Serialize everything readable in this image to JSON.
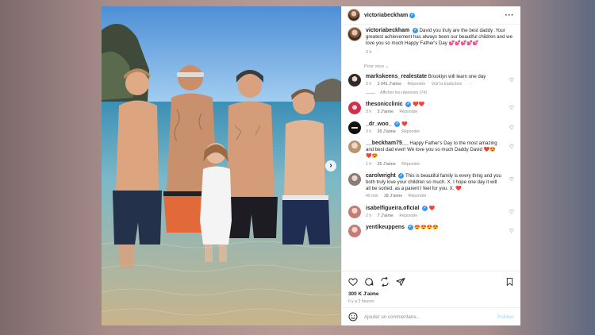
{
  "post": {
    "account": "victoriabeckham",
    "caption": "David you truly are the best daddy .Your greatest achievement has always been our beautiful children and we love you so much.Happy Father's Day 💕💕💕💕💕",
    "caption_time": "3 h",
    "section_label": "Pour vous",
    "likes": "300 K J'aime",
    "posted_ago": "Il y a 3 heures",
    "add_comment_placeholder": "Ajouter un commentaire...",
    "publish_label": "Publier"
  },
  "comments": [
    {
      "user": "markskeens_realestate",
      "verified": false,
      "text": "Brooklyn will learn one day",
      "time": "3 h",
      "likes": "3 041 J'aime",
      "reply": "Répondre",
      "translate": "Voir la traduction",
      "more": "···",
      "avatar": "dark"
    },
    {
      "user": "thesonicclinic",
      "verified": true,
      "text": "❤️❤️",
      "time": "3 h",
      "likes": "3 J'aime",
      "reply": "Répondre",
      "avatar": "red"
    },
    {
      "user": "_dr_woo_",
      "verified": true,
      "text": "❤️",
      "time": "3 h",
      "likes": "30 J'aime",
      "reply": "Répondre",
      "avatar": "black"
    },
    {
      "user": "__beckham75__",
      "verified": false,
      "text": "Happy Father's Day to the most amazing and best dad ever! We love you so much Daddy David ❤️😍❤️😍",
      "time": "1 h",
      "likes": "25 J'aime",
      "reply": "Répondre",
      "avatar": "tan"
    },
    {
      "user": "carolwright",
      "verified": true,
      "text": "This is beautiful family is every thing and you both truly love your children so much. X. I hope one day it will all be sorted, as a parent I feel for you. X. ❤️",
      "time": "40 min",
      "likes": "18 J'aime",
      "reply": "Répondre",
      "avatar": "gray"
    },
    {
      "user": "isabelfigueira.oficial",
      "verified": true,
      "text": "❤️",
      "time": "2 h",
      "likes": "7 J'aime",
      "reply": "Répondre",
      "avatar": "pink"
    },
    {
      "user": "yentlkeuppens",
      "verified": true,
      "text": "😍😍😍😍",
      "time": "",
      "likes": "",
      "reply": "",
      "avatar": "pink"
    }
  ],
  "view_replies": "Afficher les réponses (74)",
  "icons": [
    "heart-icon",
    "comment-icon",
    "share-icon",
    "send-icon",
    "bookmark-icon",
    "emoji-icon",
    "more-icon"
  ],
  "colors": {
    "accent": "#3897f0",
    "publish": "#b2dffc",
    "like_red": "#ed4956"
  }
}
